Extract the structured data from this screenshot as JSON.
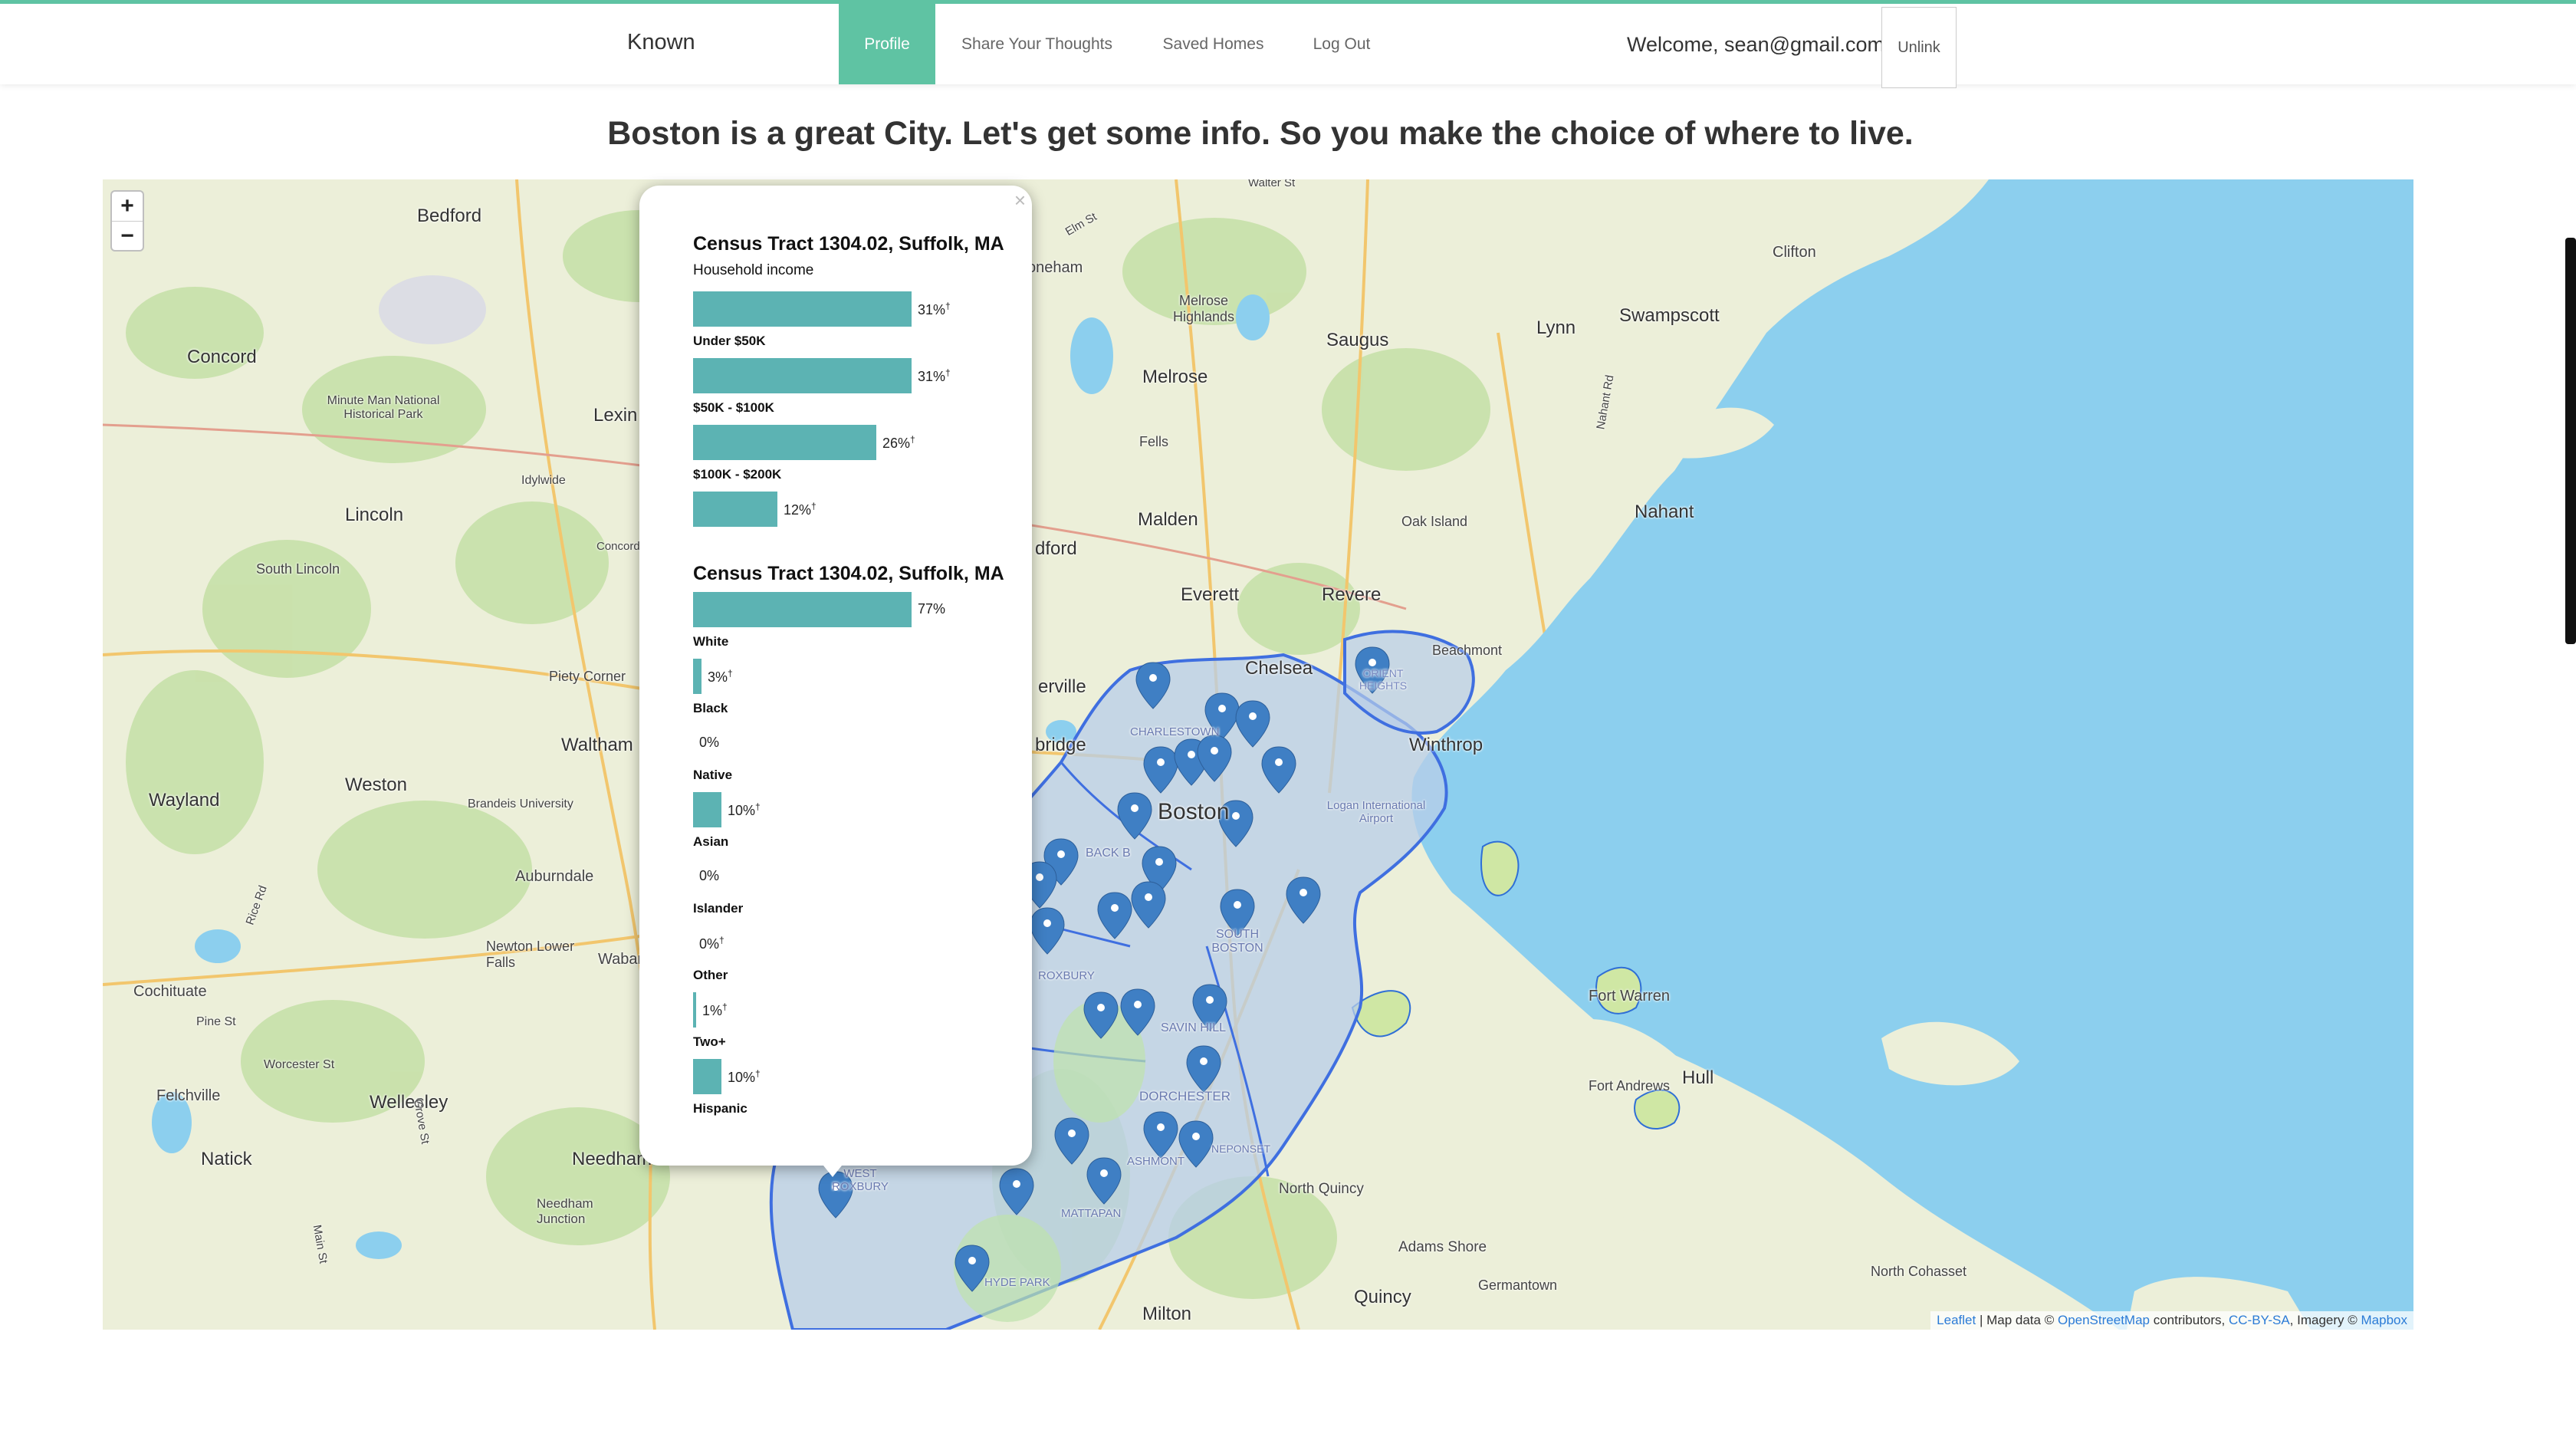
{
  "nav": {
    "brand": "Known",
    "items": [
      {
        "label": "Profile",
        "active": true
      },
      {
        "label": "Share Your Thoughts"
      },
      {
        "label": "Saved Homes"
      },
      {
        "label": "Log Out"
      }
    ],
    "welcome": "Welcome, sean@gmail.com",
    "unlink": "Unlink"
  },
  "headline": "Boston is a great City. Let's get some info. So you make the choice of where to live.",
  "map": {
    "zoom_in": "+",
    "zoom_out": "−",
    "place_labels": [
      "Bedford",
      "Concord",
      "Lexin",
      "Lincoln",
      "South Lincoln",
      "Piety Corner",
      "Waltham",
      "Weston",
      "Wayland",
      "Brandeis University",
      "Auburndale",
      "Newton Lower Falls",
      "Cochituate",
      "Felchville",
      "Wellesley",
      "Natick",
      "Needham",
      "Needham Junction",
      "Minute Man National Historical Park",
      "Idylwide",
      "Pine St",
      "Worcester St",
      "Melrose Highlands",
      "Saugus",
      "Lynn",
      "Swampscott",
      "Clifton",
      "Melrose",
      "Nahant",
      "Malden",
      "Oak Island",
      "Everett",
      "Revere",
      "Chelsea",
      "Beachmont",
      "Winthrop",
      "Boston",
      "Fells",
      "Fort Warren",
      "Fort Andrews",
      "Hull",
      "North Quincy",
      "Adams Shore",
      "Germantown",
      "Quincy",
      "North Cohasset",
      "Milton",
      "Concord Tpke",
      "Nahant Rd",
      "Wabar",
      "erville",
      "bridge",
      "dford",
      "oneham",
      "ORIENT HEIGHTS",
      "CHARLESTOWN",
      "BACK B",
      "SOUTH BOSTON",
      "ROXBURY",
      "SAVIN HILL",
      "DORCHESTER",
      "ASHMONT",
      "MATTAPAN",
      "NEPONSET",
      "WEST ROXBURY",
      "HYDE PARK",
      "Logan International Airport",
      "Elm St",
      "Walter St",
      "Grove St",
      "Main St",
      "Rice Rd"
    ],
    "attribution": {
      "leaflet": "Leaflet",
      "mapdata": "| Map data ©",
      "osm": "OpenStreetMap",
      "contrib": "contributors,",
      "license": "CC-BY-SA",
      "imagery": ", Imagery ©",
      "mapbox": "Mapbox"
    }
  },
  "popup": {
    "close": "×",
    "income": {
      "title": "Census Tract 1304.02, Suffolk, MA",
      "subtitle": "Household income",
      "bars": [
        {
          "label": "Under $50K",
          "value": 31,
          "text": "31%",
          "dagger": "†"
        },
        {
          "label": "$50K - $100K",
          "value": 31,
          "text": "31%",
          "dagger": "†"
        },
        {
          "label": "$100K - $200K",
          "value": 26,
          "text": "26%",
          "dagger": "†"
        },
        {
          "label": "",
          "value": 12,
          "text": "12%",
          "dagger": "†"
        }
      ]
    },
    "race": {
      "title": "Census Tract 1304.02, Suffolk, MA",
      "bars": [
        {
          "label": "White",
          "value": 77,
          "text": "77%",
          "dagger": ""
        },
        {
          "label": "Black",
          "value": 3,
          "text": "3%",
          "dagger": "†"
        },
        {
          "label": "Native",
          "value": 0,
          "text": "0%",
          "dagger": ""
        },
        {
          "label": "Asian",
          "value": 10,
          "text": "10%",
          "dagger": "†"
        },
        {
          "label": "Islander",
          "value": 0,
          "text": "0%",
          "dagger": ""
        },
        {
          "label": "Other",
          "value": 0,
          "text": "0%",
          "dagger": "†"
        },
        {
          "label": "Two+",
          "value": 1,
          "text": "1%",
          "dagger": "†"
        },
        {
          "label": "Hispanic",
          "value": 10,
          "text": "10%",
          "dagger": "†"
        }
      ]
    }
  },
  "colors": {
    "accent": "#5fc3a3",
    "bar": "#5cb3b3",
    "water": "#8ccfee",
    "marker": "#3f7fc4",
    "region": "#4d7ef0"
  }
}
